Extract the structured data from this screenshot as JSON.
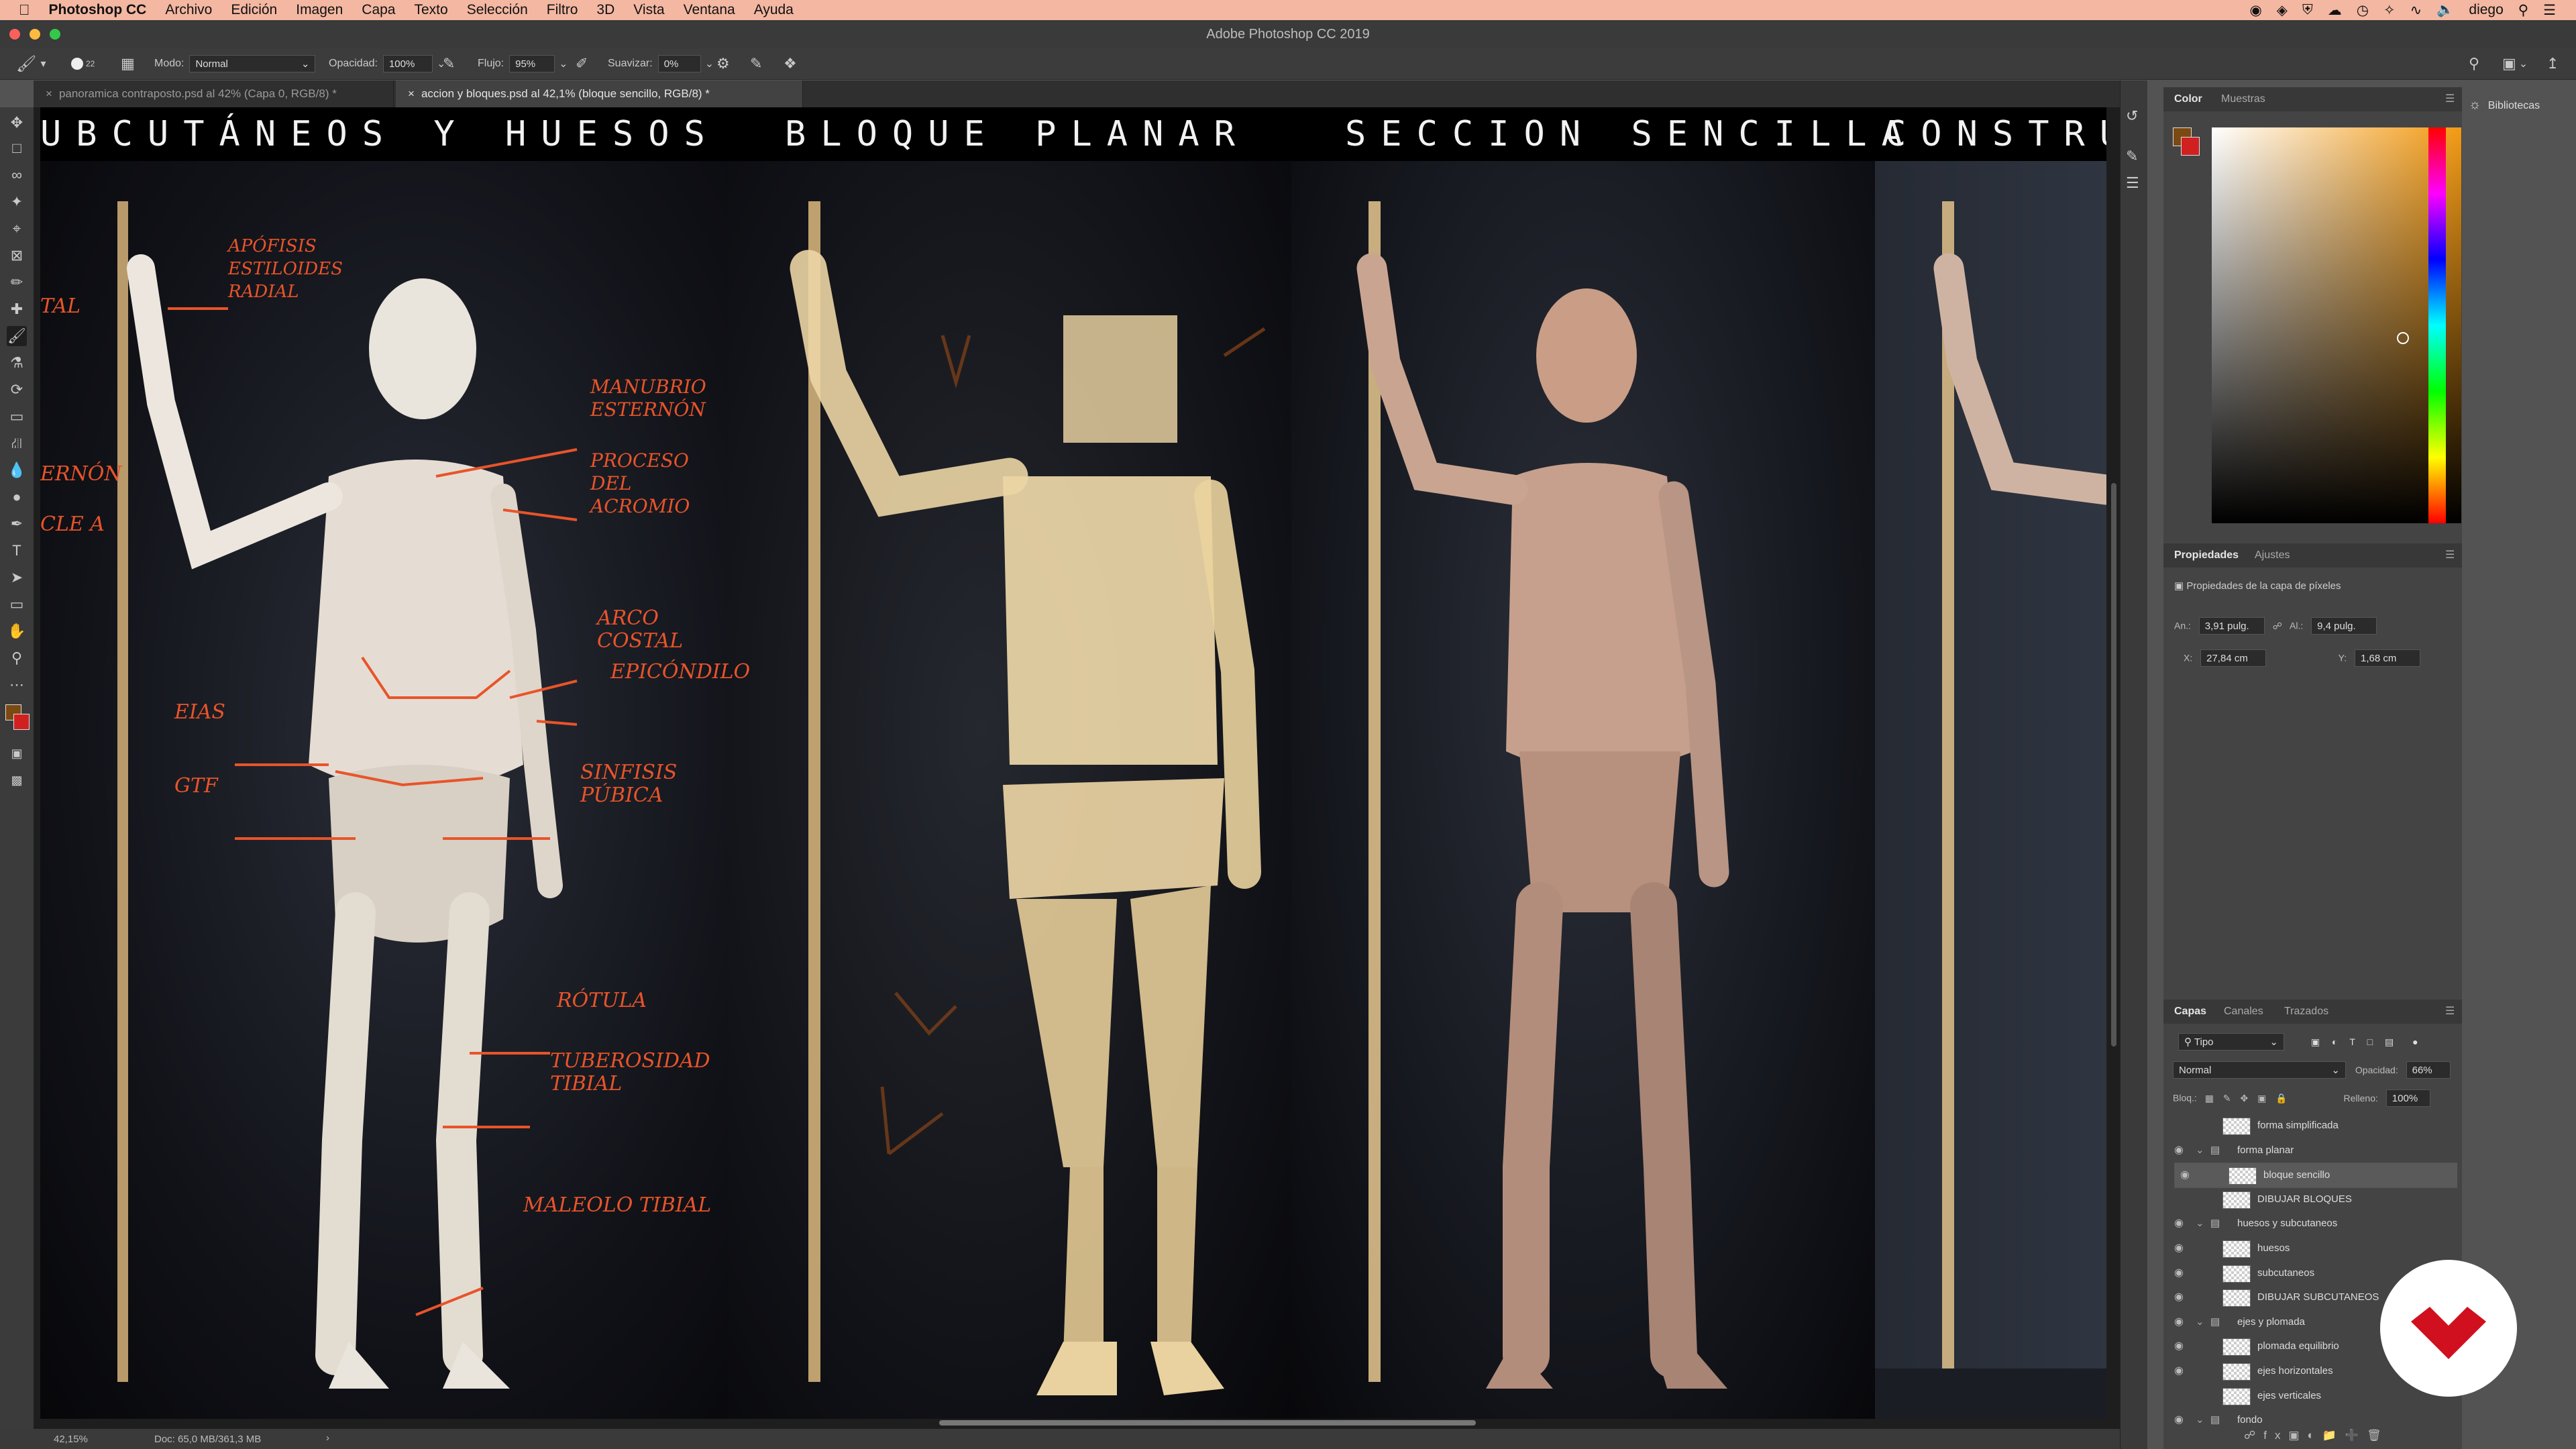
{
  "menubar": {
    "app": "Photoshop CC",
    "items": [
      "Archivo",
      "Edición",
      "Imagen",
      "Capa",
      "Texto",
      "Selección",
      "Filtro",
      "3D",
      "Vista",
      "Ventana",
      "Ayuda"
    ],
    "user": "diego"
  },
  "window": {
    "title": "Adobe Photoshop CC 2019"
  },
  "options": {
    "brush_size": "22",
    "mode_label": "Modo:",
    "mode_value": "Normal",
    "opacity_label": "Opacidad:",
    "opacity_value": "100%",
    "flow_label": "Flujo:",
    "flow_value": "95%",
    "smooth_label": "Suavizar:",
    "smooth_value": "0%"
  },
  "tabs": [
    {
      "label": "panoramica contraposto.psd al 42% (Capa 0, RGB/8) *"
    },
    {
      "label": "accion y bloques.psd al 42,1% (bloque sencillo, RGB/8) *"
    }
  ],
  "canvas": {
    "headings": [
      "UBCUTÁNEOS Y HUESOS",
      "BLOQUE PLANAR",
      "SECCION SENCILLA",
      "CONSTRUCC"
    ],
    "annotations": [
      "APÓFISIS ESTILOIDES RADIAL",
      "MANUBRIO ESTERNÓN",
      "PROCESO DEL ACROMIO",
      "ARCO COSTAL",
      "EPICÓNDILO",
      "EIAS",
      "GTF",
      "SINFISIS PÚBICA",
      "RÓTULA",
      "TUBEROSIDAD TIBIAL",
      "MALEOLO TIBIAL",
      "TAL",
      "ERNÓN",
      "CLE A"
    ]
  },
  "status": {
    "zoom": "42,15%",
    "doc": "Doc: 65,0 MB/361,3 MB"
  },
  "color_panel": {
    "tabs": [
      "Color",
      "Muestras"
    ],
    "foreground": "#7a4a12",
    "background": "#d02020"
  },
  "libraries": {
    "label": "Bibliotecas"
  },
  "properties": {
    "tabs": [
      "Propiedades",
      "Ajustes"
    ],
    "subtitle": "Propiedades de la capa de píxeles",
    "an_label": "An.:",
    "an_value": "3,91 pulg.",
    "al_label": "Al.:",
    "al_value": "9,4 pulg.",
    "x_label": "X:",
    "x_value": "27,84 cm",
    "y_label": "Y:",
    "y_value": "1,68 cm"
  },
  "layers_panel": {
    "tabs": [
      "Capas",
      "Canales",
      "Trazados"
    ],
    "filter": "Tipo",
    "blend": "Normal",
    "opacity_label": "Opacidad:",
    "opacity_value": "66%",
    "lock_label": "Bloq.:",
    "fill_label": "Relleno:",
    "fill_value": "100%",
    "layers": [
      {
        "name": "forma simplificada",
        "group": false,
        "visible": false,
        "selected": false
      },
      {
        "name": "forma planar",
        "group": true,
        "visible": true,
        "selected": false
      },
      {
        "name": "bloque sencillo",
        "group": false,
        "visible": true,
        "selected": true
      },
      {
        "name": "DIBUJAR BLOQUES",
        "group": false,
        "visible": false,
        "selected": false
      },
      {
        "name": "huesos y subcutaneos",
        "group": true,
        "visible": true,
        "selected": false
      },
      {
        "name": "huesos",
        "group": false,
        "visible": true,
        "selected": false
      },
      {
        "name": "subcutaneos",
        "group": false,
        "visible": true,
        "selected": false
      },
      {
        "name": "DIBUJAR SUBCUTANEOS",
        "group": false,
        "visible": true,
        "selected": false
      },
      {
        "name": "ejes y plomada",
        "group": true,
        "visible": true,
        "selected": false
      },
      {
        "name": "plomada equilibrio",
        "group": false,
        "visible": true,
        "selected": false
      },
      {
        "name": "ejes horizontales",
        "group": false,
        "visible": true,
        "selected": false
      },
      {
        "name": "ejes verticales",
        "group": false,
        "visible": false,
        "selected": false
      },
      {
        "name": "fondo",
        "group": true,
        "visible": true,
        "selected": false
      }
    ]
  },
  "colors": {
    "accent_annotation": "#e8542a",
    "menubar": "#f3b7a2",
    "logo_red": "#d0101e"
  }
}
